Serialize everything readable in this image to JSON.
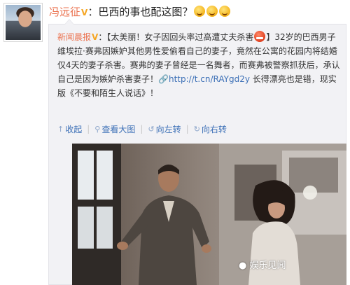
{
  "post": {
    "author": "冯远征",
    "verified_badge": "V",
    "colon": "：",
    "text": "巴西的事也配这图？",
    "emoji_name": "grin-emoji"
  },
  "repost": {
    "source": "新闻晨报",
    "verified_badge": "V",
    "colon": "：",
    "headline": "【太美丽！女子因回头率过高遭丈夫杀害",
    "headline_emoji": "angry-emoji",
    "bracket_close": "】",
    "body": "32岁的巴西男子维埃拉·赛弗因嫉妒其他男性爱偷看自己的妻子，竟然在公寓的花园内将结婚仅4天的妻子杀害。赛弗的妻子曾经是一名舞者，而赛弗被警察抓获后，承认自己是因为嫉妒杀害妻子！",
    "link_icon": "link-icon",
    "link_text": "http://t.cn/RAYgd2y",
    "tail": " 长得漂亮也是错，现实版《不要和陌生人说话》！",
    "toolbar": {
      "collapse": "收起",
      "view_large": "查看大图",
      "rotate_left": "向左转",
      "rotate_right": "向右转",
      "collapse_icon": "arrow-up-icon",
      "view_icon": "magnifier-icon",
      "rotate_left_icon": "rotate-left-icon",
      "rotate_right_icon": "rotate-right-icon"
    }
  },
  "watermark": {
    "text": "娱乐见闻",
    "icon": "wechat-icon"
  },
  "colors": {
    "author": "#eb7350",
    "link": "#3b6fb6",
    "repost_bg": "#f2f2f5"
  }
}
